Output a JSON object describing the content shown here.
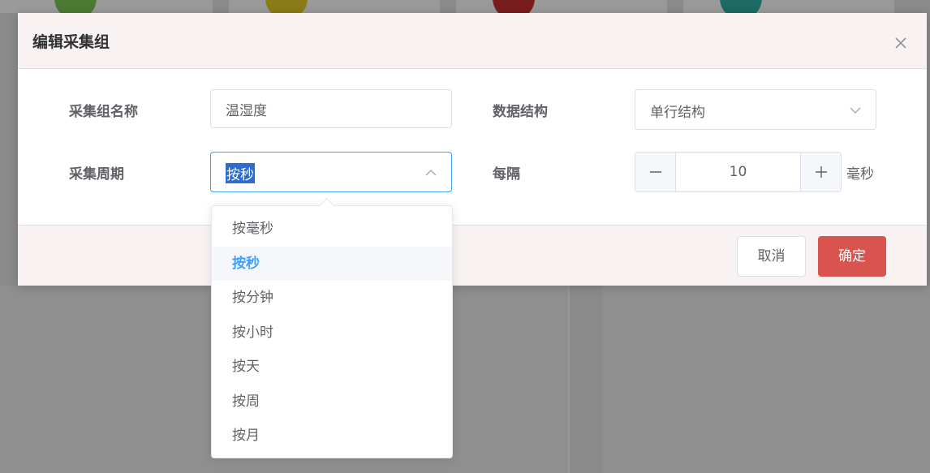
{
  "dialog": {
    "title": "编辑采集组",
    "close_icon": "close-icon"
  },
  "form": {
    "group_name_label": "采集组名称",
    "group_name_value": "温湿度",
    "data_structure_label": "数据结构",
    "data_structure_value": "单行结构",
    "period_label": "采集周期",
    "period_value": "按秒",
    "interval_label": "每隔",
    "interval_value": "10",
    "interval_unit": "毫秒"
  },
  "period_options": [
    {
      "label": "按毫秒",
      "selected": false
    },
    {
      "label": "按秒",
      "selected": true
    },
    {
      "label": "按分钟",
      "selected": false
    },
    {
      "label": "按小时",
      "selected": false
    },
    {
      "label": "按天",
      "selected": false
    },
    {
      "label": "按周",
      "selected": false
    },
    {
      "label": "按月",
      "selected": false
    }
  ],
  "footer": {
    "cancel_label": "取消",
    "ok_label": "确定"
  },
  "colors": {
    "primary": "#409eff",
    "danger": "#d9534f",
    "overlay": "#8a8a8a"
  }
}
